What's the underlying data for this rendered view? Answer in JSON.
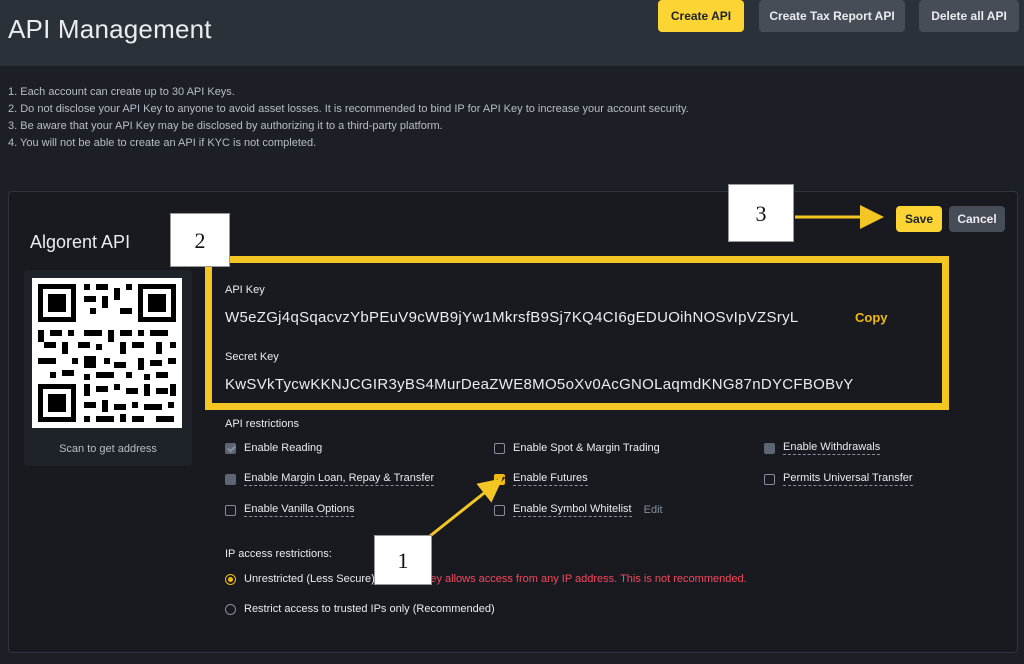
{
  "header": {
    "title": "API Management",
    "create_api": "Create API",
    "create_tax_report_api": "Create Tax Report API",
    "delete_all_api": "Delete all API"
  },
  "notes": [
    "1. Each account can create up to 30 API Keys.",
    "2. Do not disclose your API Key to anyone to avoid asset losses. It is recommended to bind IP for API Key to increase your account security.",
    "3. Be aware that your API Key may be disclosed by authorizing it to a third-party platform.",
    "4. You will not be able to create an API if KYC is not completed."
  ],
  "api": {
    "name": "Algorent API",
    "save": "Save",
    "cancel": "Cancel",
    "qr_label": "Scan to get address",
    "api_key_label": "API Key",
    "api_key": "W5eZGj4qSqacvzYbPEuV9cWB9jYw1MkrsfB9Sj7KQ4CI6gEDUOihNOSvIpVZSryL",
    "copy": "Copy",
    "secret_key_label": "Secret Key",
    "secret_key": "KwSVkTycwKKNJCGIR3yBS4MurDeaZWE8MO5oXv0AcGNOLaqmdKNG87nDYCFBOBvY"
  },
  "restrictions": {
    "title": "API restrictions",
    "enable_reading": "Enable Reading",
    "enable_margin_loan": "Enable Margin Loan, Repay & Transfer",
    "enable_vanilla_options": "Enable Vanilla Options",
    "enable_spot_margin": "Enable Spot & Margin Trading",
    "enable_futures": "Enable Futures",
    "enable_symbol_whitelist": "Enable Symbol Whitelist",
    "edit": "Edit",
    "enable_withdrawals": "Enable Withdrawals",
    "permits_universal_transfer": "Permits Universal Transfer"
  },
  "ip": {
    "title": "IP access restrictions:",
    "unrestricted": "Unrestricted (Less Secure)",
    "unrestricted_warning": "This API key allows access from any IP address. This is not recommended.",
    "restricted": "Restrict access to trusted IPs only (Recommended)"
  },
  "callouts": {
    "one": "1",
    "two": "2",
    "three": "3"
  },
  "colors": {
    "accent": "#f0b90b",
    "highlight_frame": "#f3c623",
    "warning": "#f6465d"
  }
}
